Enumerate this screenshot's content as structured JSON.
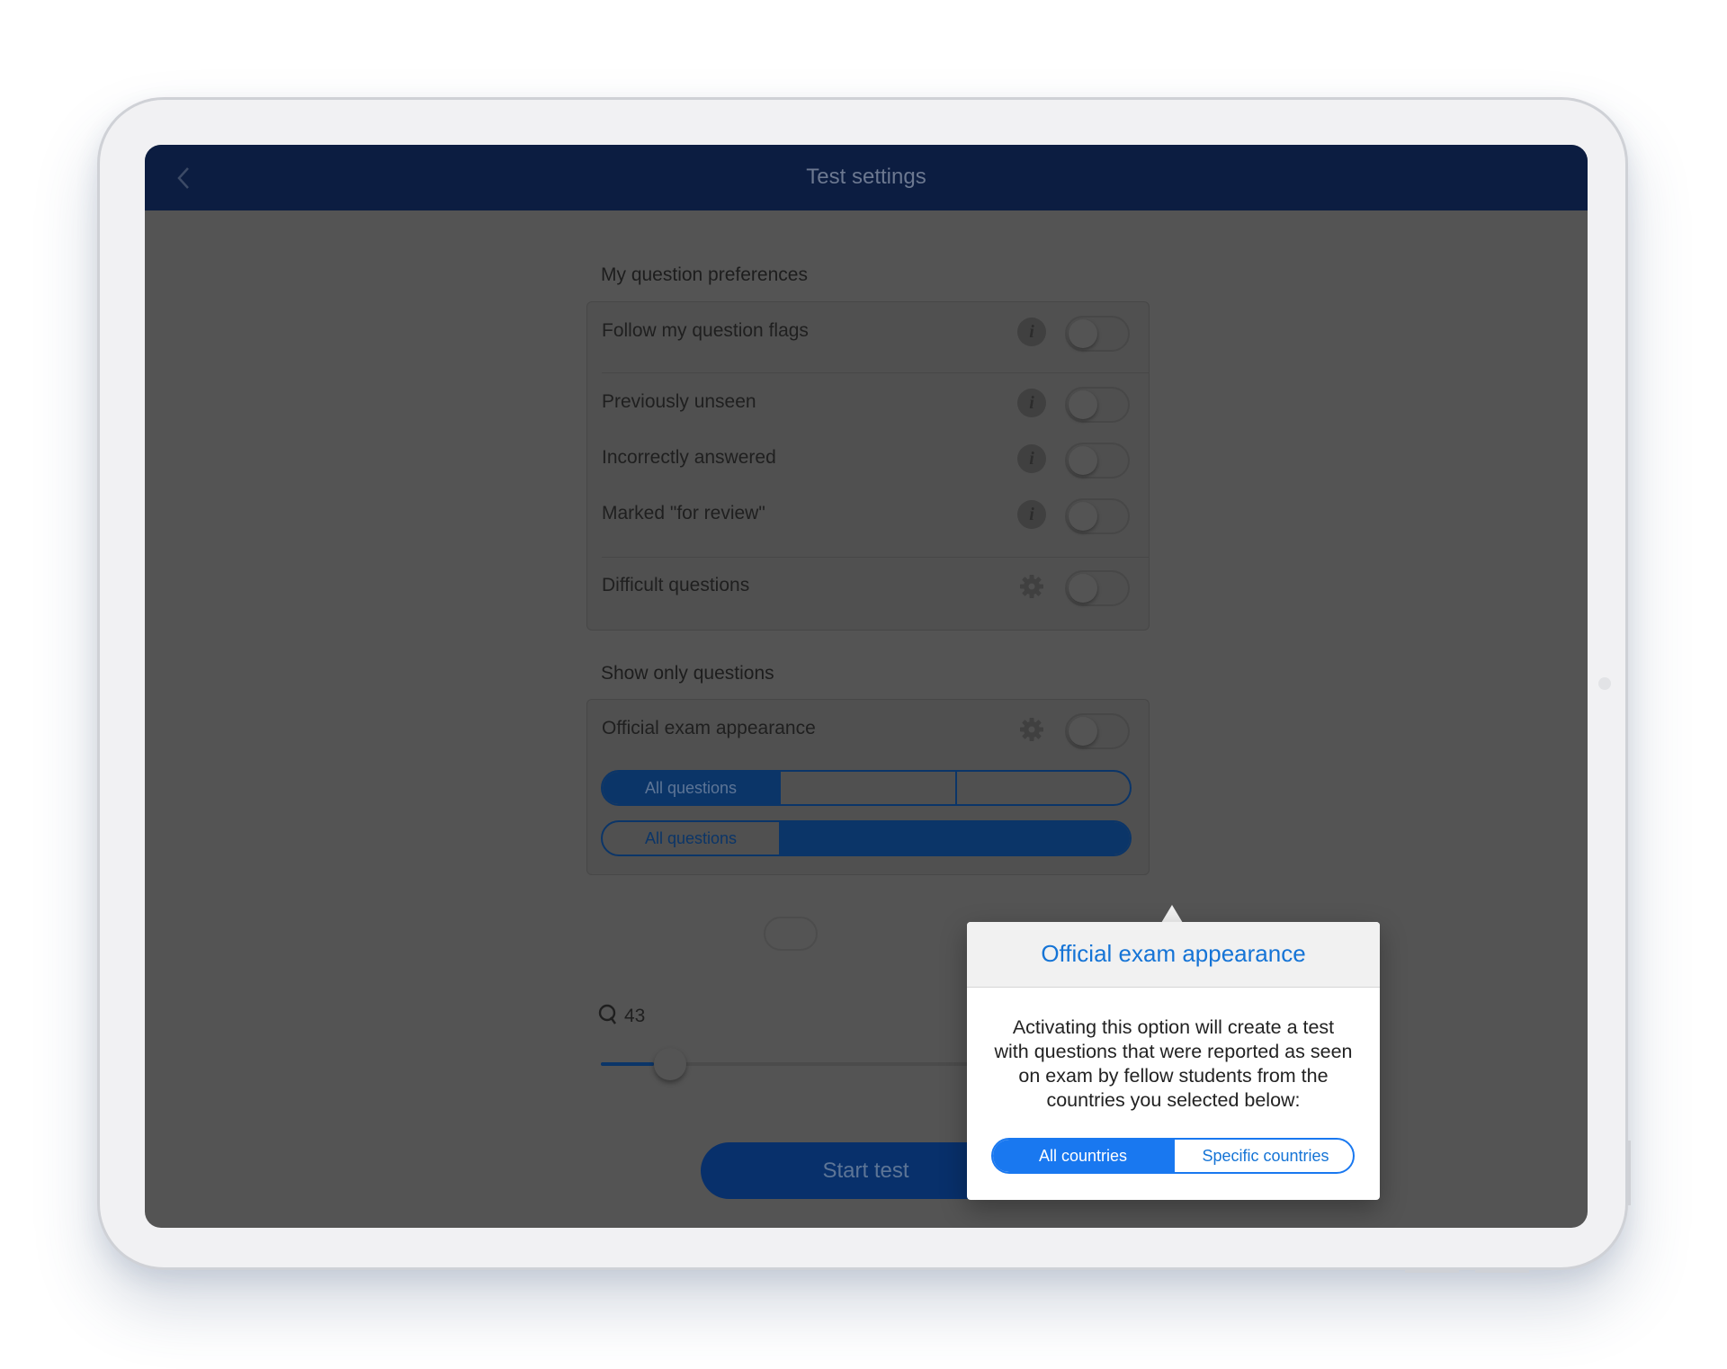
{
  "nav": {
    "title": "Test settings",
    "back_icon": "chevron-left-icon"
  },
  "preferences": {
    "heading": "My question preferences",
    "rows": [
      {
        "label": "Follow my question flags",
        "icon": "info-icon",
        "on": false
      },
      {
        "label": "Previously unseen",
        "icon": "info-icon",
        "on": false
      },
      {
        "label": "Incorrectly answered",
        "icon": "info-icon",
        "on": false
      },
      {
        "label": "Marked \"for review\"",
        "icon": "info-icon",
        "on": false
      },
      {
        "label": "Difficult questions",
        "icon": "gear-icon",
        "on": false
      }
    ]
  },
  "show_only": {
    "heading": "Show only questions",
    "official_exam": {
      "label": "Official exam appearance",
      "icon": "gear-icon",
      "on": false
    },
    "segment_a": {
      "selected": "All questions"
    },
    "segment_b": {
      "first": "All questions"
    }
  },
  "question_count": {
    "icon": "question-count-icon",
    "value": "43",
    "fraction": 0.1
  },
  "start_button": "Start test",
  "popover": {
    "title": "Official exam appearance",
    "body": "Activating this option will create a test with questions that were reported as seen on exam by fellow students from the countries you selected below:",
    "options": [
      "All countries",
      "Specific countries"
    ],
    "selected": "All countries"
  },
  "colors": {
    "nav_bg": "#0c1d41",
    "accent": "#1978f0",
    "dim_accent": "#0b3568",
    "overlay": "#545454"
  }
}
